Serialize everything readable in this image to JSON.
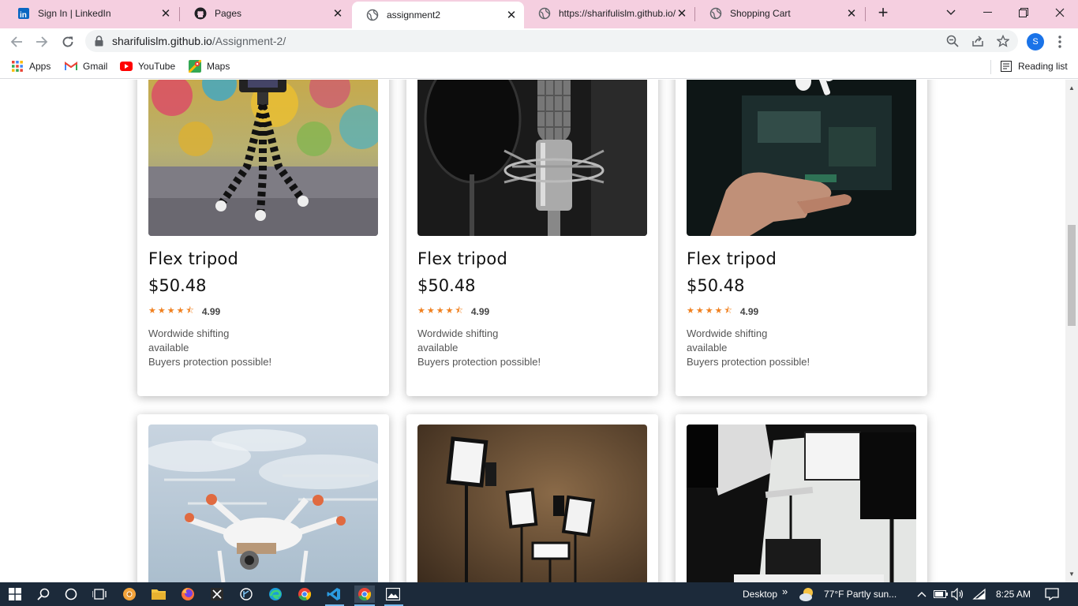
{
  "browser": {
    "tabs": [
      {
        "title": "Sign In | LinkedIn",
        "icon": "linkedin-icon",
        "active": false
      },
      {
        "title": "Pages",
        "icon": "github-icon",
        "active": false
      },
      {
        "title": "assignment2",
        "icon": "globe-icon",
        "active": true
      },
      {
        "title": "https://sharifulislm.github.io/",
        "icon": "globe-icon",
        "active": false
      },
      {
        "title": "Shopping Cart",
        "icon": "globe-icon",
        "active": false
      }
    ],
    "new_tab": "+",
    "url_host": "sharifulislm.github.io",
    "url_path": "/Assignment-2/",
    "avatar_letter": "S"
  },
  "bookmarks": {
    "apps": "Apps",
    "gmail": "Gmail",
    "youtube": "YouTube",
    "maps": "Maps",
    "reading_list": "Reading list"
  },
  "products": [
    {
      "name": "Flex tripod",
      "price": "$50.48",
      "rating": "4.99",
      "desc1": "Wordwide shifting",
      "desc2": "available",
      "desc3": "Buyers protection possible!",
      "image": "tripod-camera-image"
    },
    {
      "name": "Flex tripod",
      "price": "$50.48",
      "rating": "4.99",
      "desc1": "Wordwide shifting",
      "desc2": "available",
      "desc3": "Buyers protection possible!",
      "image": "studio-microphone-image"
    },
    {
      "name": "Flex tripod",
      "price": "$50.48",
      "rating": "4.99",
      "desc1": "Wordwide shifting",
      "desc2": "available",
      "desc3": "Buyers protection possible!",
      "image": "airpod-hand-image"
    },
    {
      "image": "drone-image"
    },
    {
      "image": "led-lights-image"
    },
    {
      "image": "studio-setup-image"
    }
  ],
  "taskbar": {
    "desktop_label": "Desktop",
    "weather": "77°F  Partly sun...",
    "time": "8:25 AM"
  },
  "colors": {
    "tabstrip": "#f5cfe0",
    "star": "#f0801f",
    "taskbar": "#1c2a3a",
    "avatar": "#1a73e8"
  }
}
